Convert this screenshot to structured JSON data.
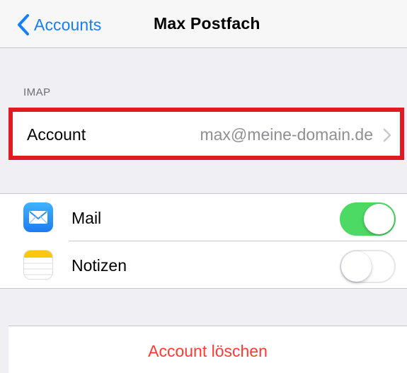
{
  "nav": {
    "back_label": "Accounts",
    "title": "Max Postfach"
  },
  "section": {
    "header": "IMAP"
  },
  "account": {
    "label": "Account",
    "value": "max@meine-domain.de"
  },
  "services": [
    {
      "label": "Mail",
      "icon": "mail-app-icon",
      "enabled": true
    },
    {
      "label": "Notizen",
      "icon": "notes-app-icon",
      "enabled": false
    }
  ],
  "delete": {
    "label": "Account löschen"
  },
  "colors": {
    "accent": "#147efb",
    "highlight_border": "#e01923",
    "toggle_on": "#4cd964",
    "destructive": "#ff3b30"
  }
}
